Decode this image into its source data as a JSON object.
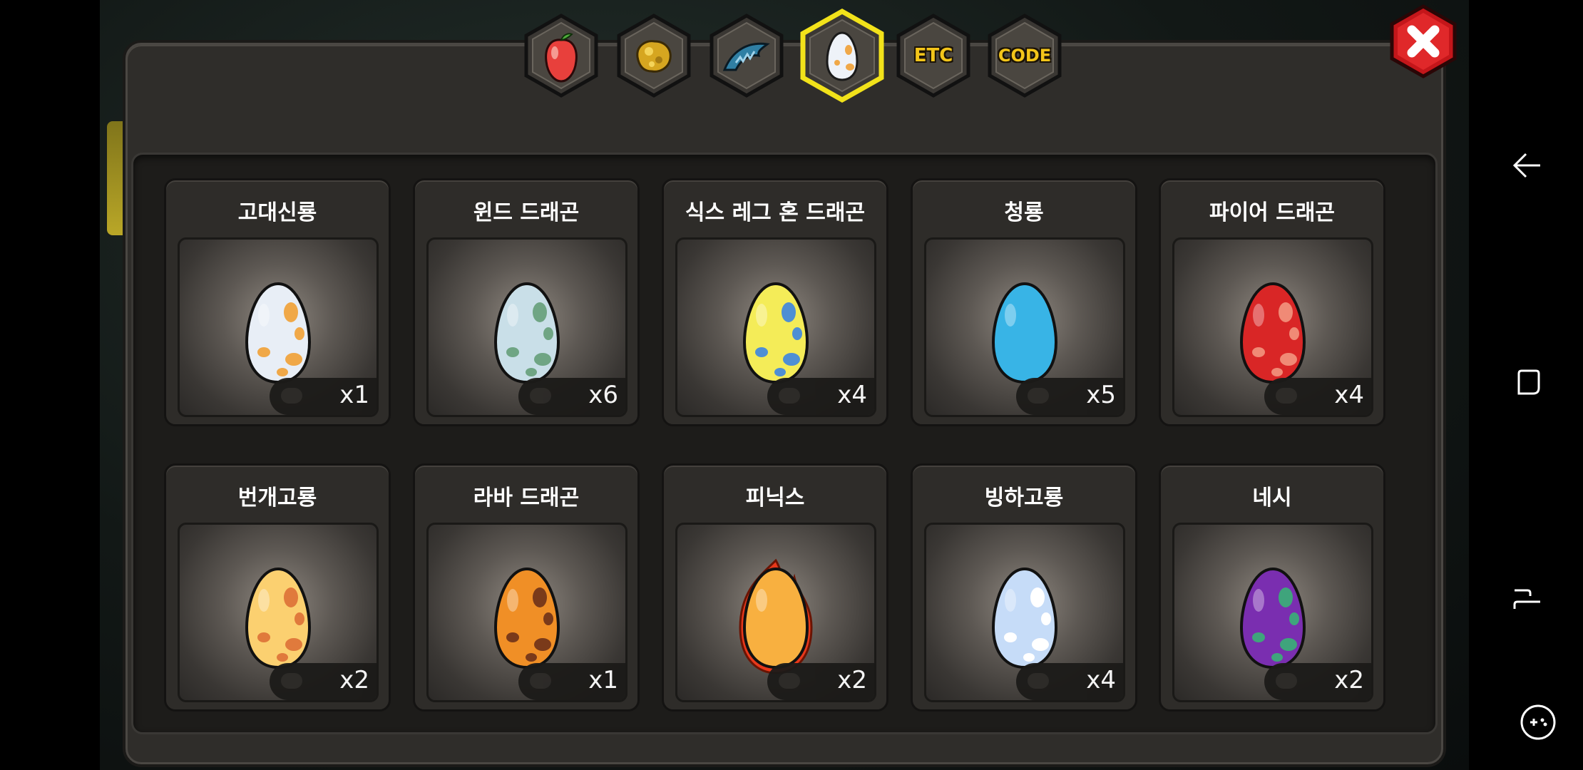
{
  "tabs": [
    {
      "name": "fruit",
      "icon": "fruit-icon",
      "active": false
    },
    {
      "name": "gold",
      "icon": "gold-nugget-icon",
      "active": false
    },
    {
      "name": "dragon",
      "icon": "dragon-icon",
      "active": false
    },
    {
      "name": "egg",
      "icon": "egg-icon",
      "active": true
    },
    {
      "name": "etc",
      "label": "ETC",
      "active": false
    },
    {
      "name": "code",
      "label": "CODE",
      "active": false
    }
  ],
  "close_icon": "close-x-icon",
  "eggs": [
    {
      "title": "고대신룡",
      "count": "x1",
      "base": "#e8eef6",
      "spot": "#f0a848"
    },
    {
      "title": "윈드 드래곤",
      "count": "x6",
      "base": "#c9dfe8",
      "spot": "#6fa584"
    },
    {
      "title": "식스 레그 혼 드래곤",
      "count": "x4",
      "base": "#f4ec58",
      "spot": "#4e8fd4"
    },
    {
      "title": "청룡",
      "count": "x5",
      "base": "#38b4e6",
      "spot": "#38b4e6"
    },
    {
      "title": "파이어 드래곤",
      "count": "x4",
      "base": "#d92626",
      "spot": "#f08a76"
    },
    {
      "title": "번개고룡",
      "count": "x2",
      "base": "#fbd070",
      "spot": "#e07a3c"
    },
    {
      "title": "라바 드래곤",
      "count": "x1",
      "base": "#f08f26",
      "spot": "#7a3a1a"
    },
    {
      "title": "피닉스",
      "count": "x2",
      "base": "#f8b040",
      "spot": "#f8b040",
      "flame": true
    },
    {
      "title": "빙하고룡",
      "count": "x4",
      "base": "#c6dcf8",
      "spot": "#ffffff"
    },
    {
      "title": "네시",
      "count": "x2",
      "base": "#7a2eb0",
      "spot": "#3fa47c"
    }
  ],
  "nav": {
    "back_icon": "back-arrow-icon",
    "recents_icon": "recents-icon",
    "home_icon": "home-icon",
    "game_icon": "game-tools-icon"
  }
}
